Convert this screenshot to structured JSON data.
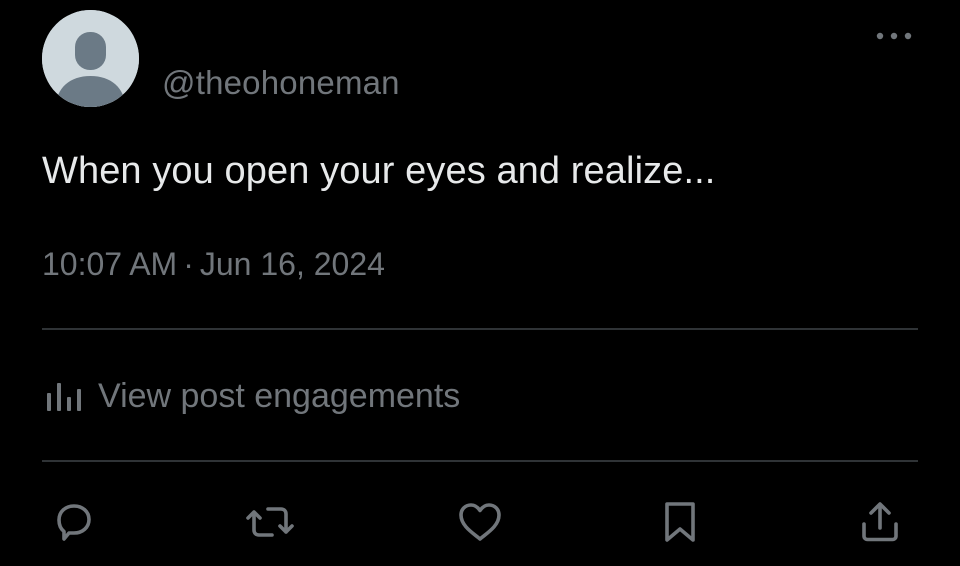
{
  "post": {
    "handle": "@theohoneman",
    "text": "When you open your eyes and realize...",
    "time": "10:07 AM",
    "separator": "·",
    "date": "Jun 16, 2024",
    "engagements_label": "View post engagements"
  },
  "actions": {
    "reply_icon": "reply-icon",
    "repost_icon": "repost-icon",
    "like_icon": "heart-icon",
    "bookmark_icon": "bookmark-icon",
    "share_icon": "share-icon"
  },
  "colors": {
    "background": "#000000",
    "primary_text": "#e7e9ea",
    "secondary_text": "#71767b",
    "divider": "#2f3336",
    "avatar_bg": "#cfd9de",
    "avatar_fg": "#6b7a86"
  }
}
